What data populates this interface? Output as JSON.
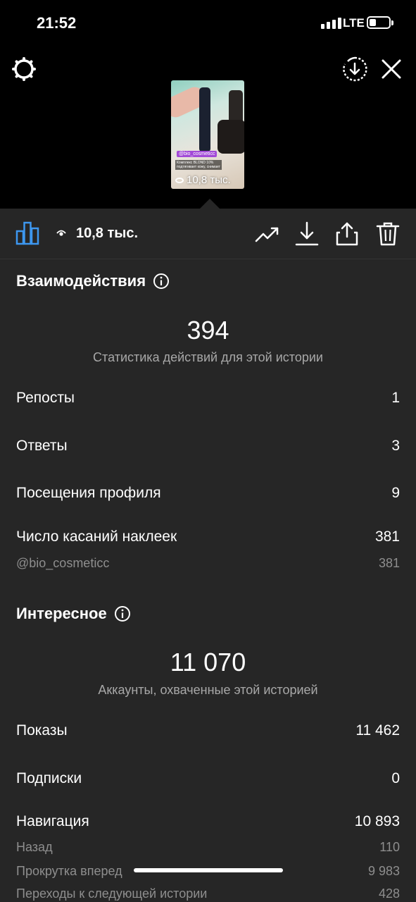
{
  "status_bar": {
    "time": "21:52",
    "network": "LTE"
  },
  "story_preview": {
    "tag": "@bio_cosmeticc",
    "caption": "Комплекс BLOND 10% подтягивает кожу, снимает",
    "views": "10,8 тыс."
  },
  "toolbar": {
    "views": "10,8 тыс."
  },
  "interactions": {
    "title": "Взаимодействия",
    "total": "394",
    "subtitle": "Статистика действий для этой истории",
    "rows": [
      {
        "label": "Репосты",
        "value": "1"
      },
      {
        "label": "Ответы",
        "value": "3"
      },
      {
        "label": "Посещения профиля",
        "value": "9"
      },
      {
        "label": "Число касаний наклеек",
        "value": "381"
      }
    ],
    "sticker_rows": [
      {
        "label": "@bio_cosmeticc",
        "value": "381"
      }
    ]
  },
  "discovery": {
    "title": "Интересное",
    "total": "11 070",
    "subtitle": "Аккаунты, охваченные этой историей",
    "rows": [
      {
        "label": "Показы",
        "value": "11 462"
      },
      {
        "label": "Подписки",
        "value": "0"
      },
      {
        "label": "Навигация",
        "value": "10 893"
      }
    ],
    "navigation_rows": [
      {
        "label": "Назад",
        "value": "110"
      },
      {
        "label": "Прокрутка вперед",
        "value": "9 983"
      },
      {
        "label": "Переходы к следующей истории",
        "value": "428"
      }
    ]
  }
}
